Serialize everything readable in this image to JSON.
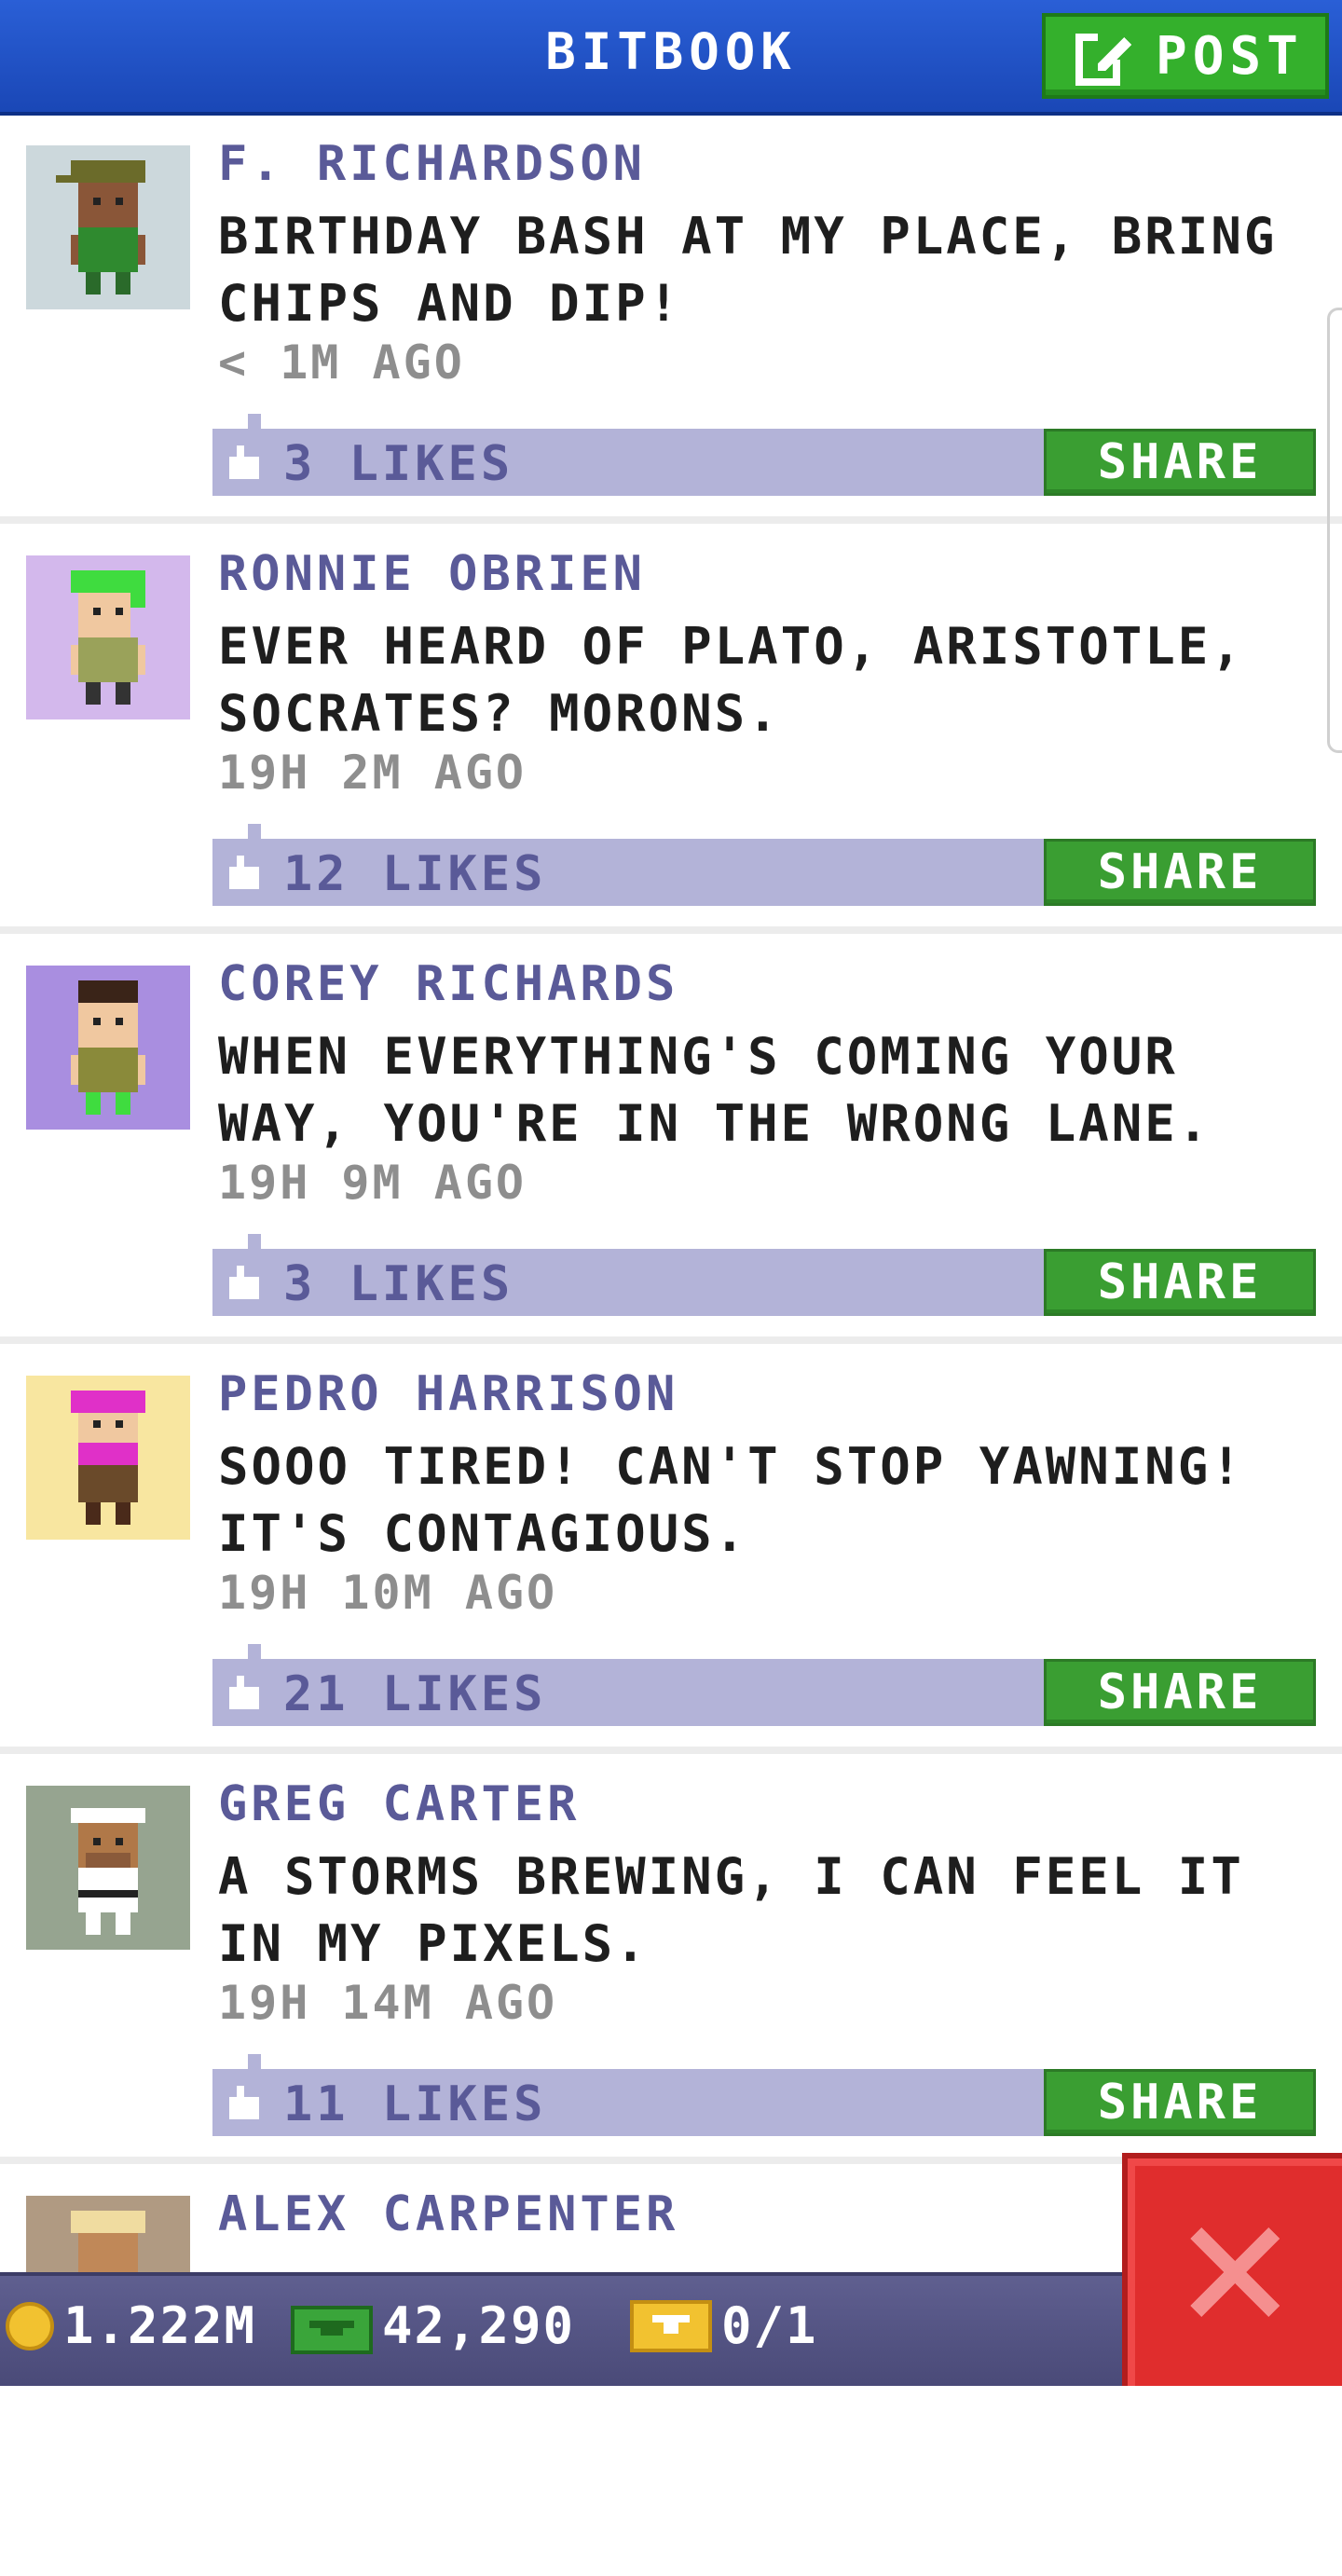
{
  "header": {
    "title": "BITBOOK",
    "post_label": "POST"
  },
  "posts": [
    {
      "author": "F. RICHARDSON",
      "message": "BIRTHDAY BASH AT MY PLACE, BRING CHIPS AND DIP!",
      "time": "< 1M AGO",
      "likes": "3 LIKES",
      "share_label": "SHARE",
      "avatar_bg": "#ccd8dc"
    },
    {
      "author": "RONNIE OBRIEN",
      "message": "EVER HEARD OF PLATO, ARISTOTLE, SOCRATES? MORONS.",
      "time": "19H 2M AGO",
      "likes": "12 LIKES",
      "share_label": "SHARE",
      "avatar_bg": "#d3b8ec"
    },
    {
      "author": "COREY RICHARDS",
      "message": "WHEN EVERYTHING'S COMING YOUR WAY, YOU'RE IN THE WRONG LANE.",
      "time": "19H 9M AGO",
      "likes": "3 LIKES",
      "share_label": "SHARE",
      "avatar_bg": "#a98ee0"
    },
    {
      "author": "PEDRO HARRISON",
      "message": "SOOO TIRED! CAN'T STOP YAWNING! IT'S CONTAGIOUS.",
      "time": "19H 10M AGO",
      "likes": "21 LIKES",
      "share_label": "SHARE",
      "avatar_bg": "#f8e6a0"
    },
    {
      "author": "GREG CARTER",
      "message": "A STORMS BREWING, I CAN FEEL IT IN MY PIXELS.",
      "time": "19H 14M AGO",
      "likes": "11 LIKES",
      "share_label": "SHARE",
      "avatar_bg": "#96a490"
    },
    {
      "author": "ALEX CARPENTER",
      "message": "",
      "time": "",
      "likes": "",
      "share_label": "",
      "avatar_bg": "#b09a82"
    }
  ],
  "status_bar": {
    "coins": "1.222M",
    "bux": "42,290",
    "tickets": "0/1"
  },
  "icons": {
    "post": "edit-icon",
    "like": "thumbs-up-icon",
    "coin": "coin-icon",
    "bux": "bux-icon",
    "ticket": "ticket-icon",
    "close": "close-icon"
  },
  "colors": {
    "header": "#1f4fc3",
    "green_button": "#3a9e32",
    "likes_bar": "#b3b3d8",
    "name_text": "#5a5a98",
    "close_button": "#e02d2d"
  }
}
